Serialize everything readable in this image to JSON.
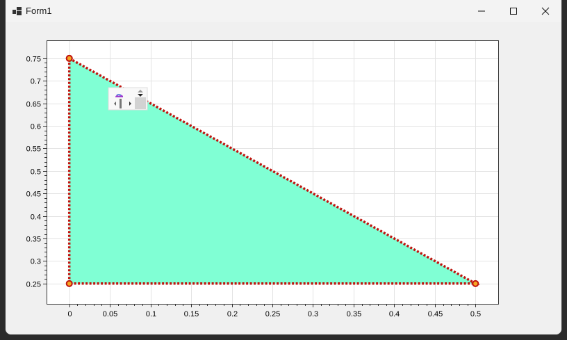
{
  "window": {
    "title": "Form1"
  },
  "icons": {
    "app": "app-form-icon",
    "minimize": "minimize-icon",
    "maximize": "maximize-icon",
    "close": "close-icon",
    "pan": "pan-hand-icon"
  },
  "chart_data": {
    "type": "area",
    "title": "",
    "xlabel": "",
    "ylabel": "",
    "xlim": [
      -0.028,
      0.528
    ],
    "ylim": [
      0.205,
      0.79
    ],
    "x_ticks": [
      0,
      0.05,
      0.1,
      0.15,
      0.2,
      0.25,
      0.3,
      0.35,
      0.4,
      0.45,
      0.5
    ],
    "x_tick_labels": [
      "0",
      "0.05",
      "0.1",
      "0.15",
      "0.2",
      "0.25",
      "0.3",
      "0.35",
      "0.4",
      "0.45",
      "0.5"
    ],
    "y_ticks": [
      0.25,
      0.3,
      0.35,
      0.4,
      0.45,
      0.5,
      0.55,
      0.6,
      0.65,
      0.7,
      0.75
    ],
    "y_tick_labels": [
      "0.25",
      "0.3",
      "0.35",
      "0.4",
      "0.45",
      "0.5",
      "0.55",
      "0.6",
      "0.65",
      "0.7",
      "0.75"
    ],
    "grid": true,
    "series": [
      {
        "x": [
          0,
          0.5,
          0,
          0
        ],
        "y": [
          0.75,
          0.25,
          0.25,
          0.75
        ],
        "fill_color": "#80ffd4",
        "line_color": "#c0140f",
        "line_style": "dotted",
        "marker_fill": "#f5a623",
        "marker_edge": "#c0140f"
      }
    ]
  },
  "colors": {
    "fill": "#80ffd4",
    "line": "#c0140f",
    "grid": "#e3e3e3"
  }
}
